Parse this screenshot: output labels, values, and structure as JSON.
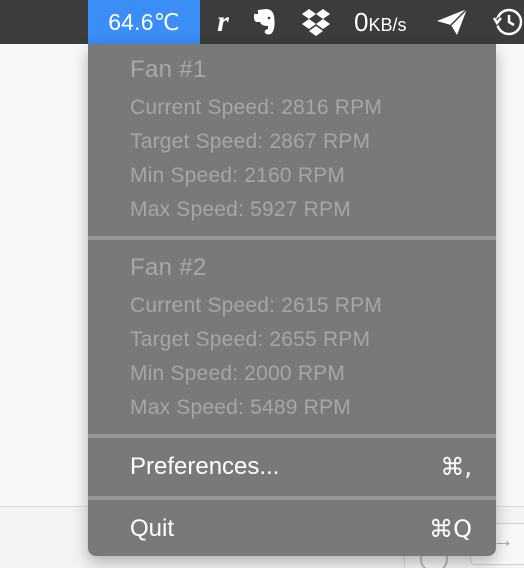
{
  "menubar": {
    "temperature": "64.6℃",
    "icons": [
      "r-icon",
      "evernote-icon",
      "dropbox-icon",
      "send-icon",
      "time-machine-icon"
    ],
    "net_speed_value": "0",
    "net_speed_unit": "KB/s",
    "accent_color": "#3a8ef6"
  },
  "fans": [
    {
      "title": "Fan  #1",
      "current": "Current Speed: 2816 RPM",
      "target": "Target Speed: 2867 RPM",
      "min": "Min Speed: 2160 RPM",
      "max": "Max Speed: 5927 RPM"
    },
    {
      "title": "Fan  #2",
      "current": "Current Speed: 2615 RPM",
      "target": "Target Speed: 2655 RPM",
      "min": "Min Speed: 2000 RPM",
      "max": "Max Speed: 5489 RPM"
    }
  ],
  "menu": {
    "preferences_label": "Preferences...",
    "preferences_shortcut": "⌘,",
    "quit_label": "Quit",
    "quit_shortcut": "⌘Q"
  }
}
